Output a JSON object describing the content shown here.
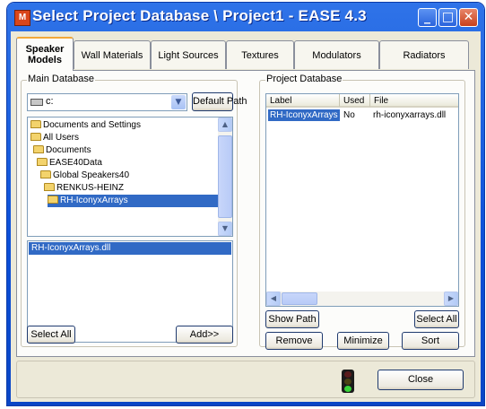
{
  "window": {
    "title": "Select Project Database \\ Project1 - EASE 4.3",
    "app_icon": "ease-app-icon",
    "controls": [
      "minimize-icon",
      "maximize-icon",
      "close-icon"
    ]
  },
  "tabs": [
    {
      "label_line1": "Speaker",
      "label_line2": "Models",
      "active": true
    },
    {
      "label": "Wall Materials"
    },
    {
      "label": "Light Sources"
    },
    {
      "label": "Textures"
    },
    {
      "label": "Modulators"
    },
    {
      "label": "Radiators"
    }
  ],
  "main_database": {
    "group_label": "Main Database",
    "drive_value": "c:",
    "default_path_label": "Default Path",
    "tree": [
      {
        "label": "Documents and Settings"
      },
      {
        "label": "All Users"
      },
      {
        "label": "Documents"
      },
      {
        "label": "EASE40Data"
      },
      {
        "label": "Global Speakers40"
      },
      {
        "label": "RENKUS-HEINZ"
      },
      {
        "label": "RH-IconyxArrays",
        "selected": true
      }
    ],
    "files": [
      "RH-IconyxArrays.dll"
    ],
    "select_all_label": "Select All",
    "add_label": "Add>>"
  },
  "project_database": {
    "group_label": "Project Database",
    "columns": [
      "Label",
      "Used",
      "File"
    ],
    "rows": [
      {
        "label": "RH-IconyxArrays",
        "used": "No",
        "file": "rh-iconyxarrays.dll"
      }
    ],
    "show_path_label": "Show Path",
    "select_all_label": "Select All",
    "remove_label": "Remove",
    "minimize_label": "Minimize",
    "sort_label": "Sort"
  },
  "footer": {
    "status_icon": "traffic-light-icon",
    "close_label": "Close"
  },
  "colors": {
    "title_bar": "#0b4fd8",
    "selection": "#316ac5",
    "dialog_bg": "#ece9d8",
    "active_tab_accent": "#f2a83a"
  }
}
